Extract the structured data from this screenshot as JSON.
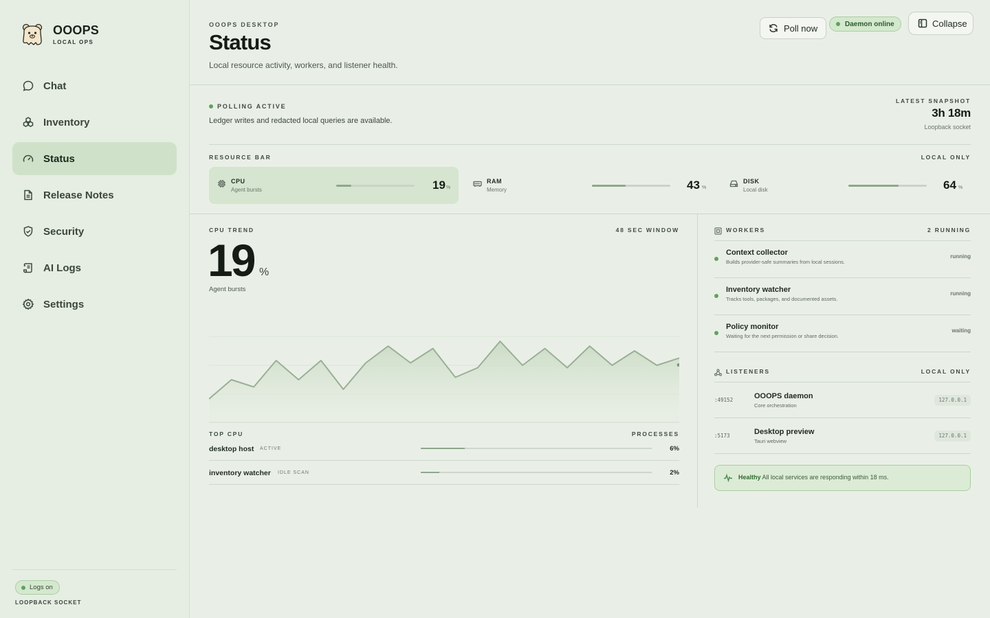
{
  "app": {
    "name": "OOOPS",
    "subtitle": "LOCAL OPS"
  },
  "nav": [
    {
      "label": "Chat",
      "icon": "chat-icon"
    },
    {
      "label": "Inventory",
      "icon": "inventory-icon"
    },
    {
      "label": "Status",
      "icon": "gauge-icon",
      "active": true
    },
    {
      "label": "Release Notes",
      "icon": "document-icon"
    },
    {
      "label": "Security",
      "icon": "shield-icon"
    },
    {
      "label": "AI Logs",
      "icon": "scroll-icon"
    },
    {
      "label": "Settings",
      "icon": "gear-icon"
    }
  ],
  "sidebar_footer": {
    "logs_label": "Logs on",
    "caption": "LOOPBACK SOCKET"
  },
  "header": {
    "eyebrow": "OOOPS DESKTOP",
    "title": "Status",
    "subtitle": "Local resource activity, workers, and listener health.",
    "poll_button": "Poll now",
    "daemon_status": "Daemon online",
    "collapse_button": "Collapse"
  },
  "polling": {
    "label": "POLLING ACTIVE",
    "description": "Ledger writes and redacted local queries are available.",
    "snapshot_label": "LATEST SNAPSHOT",
    "snapshot_value": "3h 18m",
    "snapshot_caption": "Loopback socket"
  },
  "resources": {
    "label": "RESOURCE BAR",
    "right_label": "LOCAL ONLY",
    "items": [
      {
        "name": "CPU",
        "desc": "Agent bursts",
        "value": "19",
        "unit": "%",
        "percent": 19
      },
      {
        "name": "RAM",
        "desc": "Memory",
        "value": "43",
        "unit": "%",
        "percent": 43
      },
      {
        "name": "DISK",
        "desc": "Local disk",
        "value": "64",
        "unit": "%",
        "percent": 64
      }
    ]
  },
  "cpu_trend": {
    "label": "CPU TREND",
    "window": "48 SEC WINDOW",
    "value": "19",
    "unit": "%",
    "caption": "Agent bursts"
  },
  "chart_data": {
    "type": "area",
    "title": "",
    "xlabel": "",
    "ylabel": "",
    "values": [
      10,
      18,
      15,
      26,
      18,
      26,
      14,
      25,
      32,
      25,
      31,
      19,
      23,
      34,
      24,
      31,
      23,
      32,
      24,
      30,
      24,
      27
    ],
    "ylim": [
      0,
      40
    ],
    "grid": true
  },
  "top_cpu": {
    "label": "TOP CPU",
    "right_label": "PROCESSES",
    "rows": [
      {
        "name": "desktop host",
        "tag": "ACTIVE",
        "value": "6%",
        "percent": 19
      },
      {
        "name": "inventory watcher",
        "tag": "IDLE SCAN",
        "value": "2%",
        "percent": 8
      }
    ]
  },
  "workers": {
    "label": "WORKERS",
    "right_label": "2 RUNNING",
    "items": [
      {
        "name": "Context collector",
        "desc": "Builds provider-safe summaries from local sessions.",
        "state": "running"
      },
      {
        "name": "Inventory watcher",
        "desc": "Tracks tools, packages, and documented assets.",
        "state": "running"
      },
      {
        "name": "Policy monitor",
        "desc": "Waiting for the next permission or share decision.",
        "state": "waiting"
      }
    ]
  },
  "listeners": {
    "label": "LISTENERS",
    "right_label": "LOCAL ONLY",
    "items": [
      {
        "port": ":49152",
        "name": "OOOPS daemon",
        "desc": "Core orchestration",
        "addr": "127.0.0.1"
      },
      {
        "port": ":5173",
        "name": "Desktop preview",
        "desc": "Tauri webview",
        "addr": "127.0.0.1"
      }
    ]
  },
  "health": {
    "status": "Healthy",
    "message": "All local services are responding within 18 ms."
  },
  "colors": {
    "accent": "#5fa161",
    "active_nav": "#cfe2c9",
    "background": "#e9efe6",
    "chart_line": "#9aaf96"
  }
}
